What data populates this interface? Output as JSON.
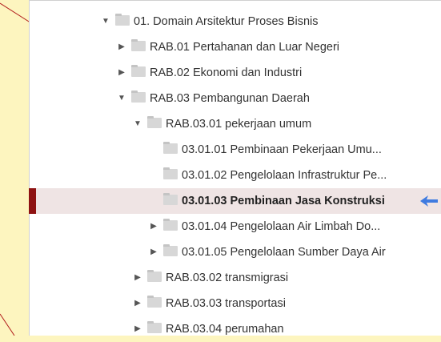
{
  "tree": [
    {
      "label": "01. Domain Arsitektur Proses Bisnis",
      "depth": 0,
      "state": "expanded"
    },
    {
      "label": "RAB.01 Pertahanan dan Luar Negeri",
      "depth": 1,
      "state": "collapsed"
    },
    {
      "label": "RAB.02 Ekonomi dan Industri",
      "depth": 1,
      "state": "collapsed"
    },
    {
      "label": "RAB.03 Pembangunan Daerah",
      "depth": 1,
      "state": "expanded"
    },
    {
      "label": "RAB.03.01 pekerjaan umum",
      "depth": 2,
      "state": "expanded"
    },
    {
      "label": "03.01.01 Pembinaan Pekerjaan Umu...",
      "depth": 3,
      "state": "leaf"
    },
    {
      "label": "03.01.02 Pengelolaan Infrastruktur Pe...",
      "depth": 3,
      "state": "leaf"
    },
    {
      "label": "03.01.03 Pembinaan Jasa Konstruksi",
      "depth": 3,
      "state": "leaf",
      "selected": true
    },
    {
      "label": "03.01.04 Pengelolaan Air Limbah Do...",
      "depth": 3,
      "state": "collapsed"
    },
    {
      "label": "03.01.05 Pengelolaan Sumber Daya Air",
      "depth": 3,
      "state": "collapsed"
    },
    {
      "label": "RAB.03.02 transmigrasi",
      "depth": 2,
      "state": "collapsed"
    },
    {
      "label": "RAB.03.03 transportasi",
      "depth": 2,
      "state": "collapsed"
    },
    {
      "label": "RAB.03.04 perumahan",
      "depth": 2,
      "state": "collapsed"
    }
  ],
  "icons": {
    "expanded": "▼",
    "collapsed": "▶",
    "folder": "folder-icon",
    "pointer": "arrow-left-icon"
  },
  "colors": {
    "selection_bar": "#8e1212",
    "selection_background": "#efe4e4",
    "pointer": "#3f7be0",
    "callout_background": "#fdf5bf"
  }
}
